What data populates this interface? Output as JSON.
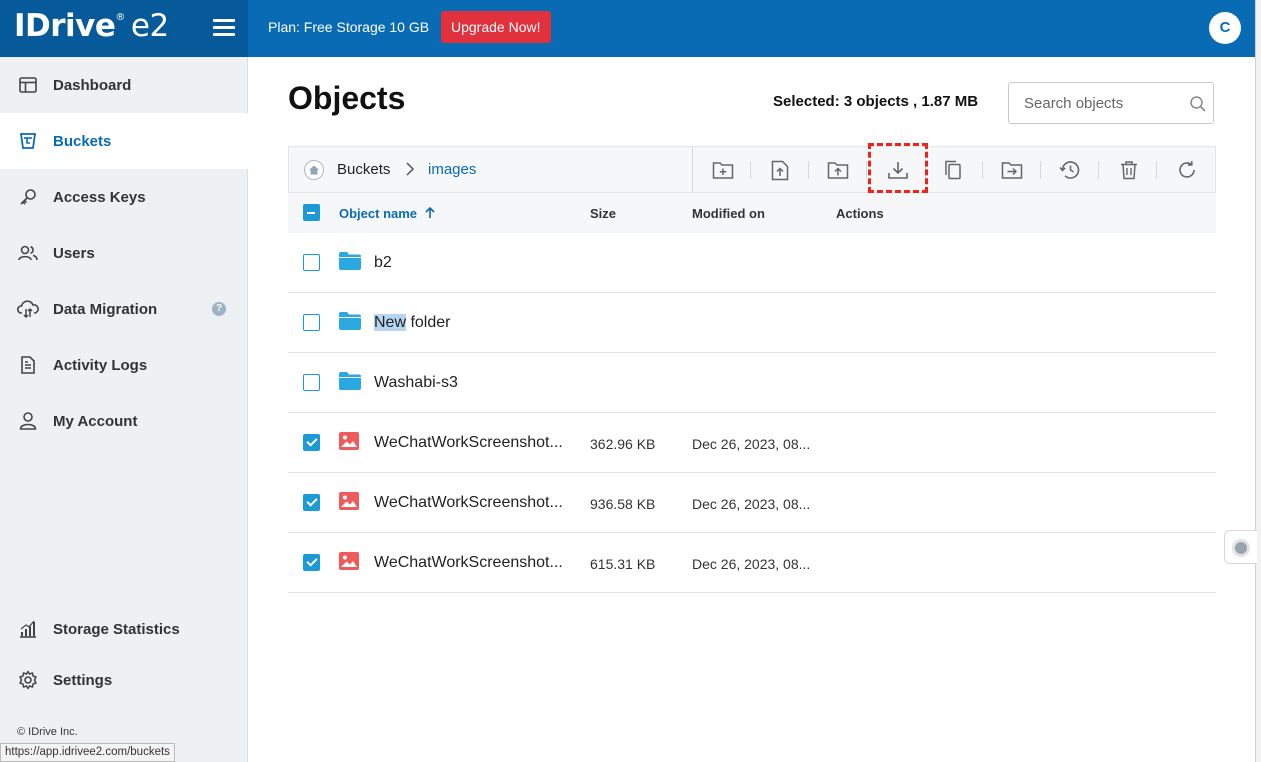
{
  "header": {
    "logo_text": "IDrive",
    "logo_suffix": "e2",
    "logo_reg": "®",
    "plan_text": "Plan: Free Storage 10 GB",
    "upgrade_label": "Upgrade Now!",
    "avatar_initial": "C"
  },
  "sidebar": {
    "items": [
      {
        "label": "Dashboard",
        "icon": "dashboard-icon"
      },
      {
        "label": "Buckets",
        "icon": "bucket-icon"
      },
      {
        "label": "Access Keys",
        "icon": "key-icon"
      },
      {
        "label": "Users",
        "icon": "users-icon"
      },
      {
        "label": "Data Migration",
        "icon": "cloud-migration-icon",
        "badge": "?"
      },
      {
        "label": "Activity Logs",
        "icon": "document-icon"
      },
      {
        "label": "My Account",
        "icon": "person-icon"
      },
      {
        "label": "Storage Statistics",
        "icon": "bar-chart-icon"
      },
      {
        "label": "Settings",
        "icon": "gear-icon"
      }
    ],
    "copyright": "© IDrive Inc."
  },
  "status_url": "https://app.idrivee2.com/buckets",
  "main": {
    "title": "Objects",
    "selected_info": "Selected: 3 objects , 1.87 MB",
    "search_placeholder": "Search objects",
    "breadcrumb": {
      "root": "Buckets",
      "current": "images"
    },
    "toolbar": [
      "create-folder-icon",
      "upload-file-icon",
      "upload-folder-icon",
      "download-icon",
      "copy-icon",
      "move-icon",
      "version-history-icon",
      "delete-icon",
      "refresh-icon"
    ],
    "columns": {
      "name": "Object name",
      "size": "Size",
      "modified": "Modified on",
      "actions": "Actions"
    },
    "rows": [
      {
        "type": "folder",
        "name": "b2",
        "size": "",
        "modified": "",
        "checked": false
      },
      {
        "type": "folder",
        "name_highlight": "New",
        "name_rest": " folder",
        "size": "",
        "modified": "",
        "checked": false
      },
      {
        "type": "folder",
        "name": "Washabi-s3",
        "size": "",
        "modified": "",
        "checked": false
      },
      {
        "type": "image",
        "name": "WeChatWorkScreenshot...",
        "size": "362.96 KB",
        "modified": "Dec 26, 2023, 08...",
        "checked": true
      },
      {
        "type": "image",
        "name": "WeChatWorkScreenshot...",
        "size": "936.58 KB",
        "modified": "Dec 26, 2023, 08...",
        "checked": true
      },
      {
        "type": "image",
        "name": "WeChatWorkScreenshot...",
        "size": "615.31 KB",
        "modified": "Dec 26, 2023, 08...",
        "checked": true
      }
    ]
  },
  "colors": {
    "primary": "#0a6bb5",
    "sidebar_bg": "#eef1f4",
    "upgrade": "#e0313d",
    "checkbox": "#1b9ad6",
    "folder": "#29a9e0",
    "image": "#ef5b5b",
    "highlight": "#f0231c"
  }
}
